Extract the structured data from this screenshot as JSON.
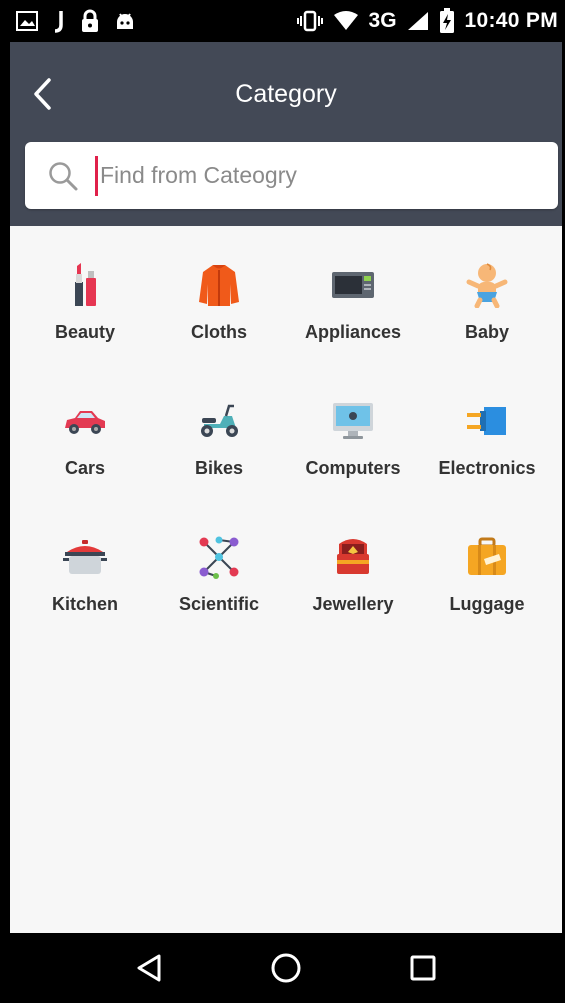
{
  "status_bar": {
    "network": "3G",
    "time": "10:40 PM",
    "left_icons": [
      "image-notification-icon",
      "j-notification-icon",
      "lock-icon",
      "android-icon"
    ],
    "right_icons": [
      "vibrate-icon",
      "wifi-icon",
      "signal-icon",
      "battery-charging-icon"
    ]
  },
  "header": {
    "title": "Category",
    "back_icon": "chevron-left-icon"
  },
  "search": {
    "placeholder": "Find from Cateogry",
    "value": "",
    "icon": "search-icon"
  },
  "categories": [
    {
      "label": "Beauty",
      "icon": "lipstick-icon"
    },
    {
      "label": "Cloths",
      "icon": "jacket-icon"
    },
    {
      "label": "Appliances",
      "icon": "microwave-icon"
    },
    {
      "label": "Baby",
      "icon": "baby-icon"
    },
    {
      "label": "Cars",
      "icon": "car-icon"
    },
    {
      "label": "Bikes",
      "icon": "scooter-icon"
    },
    {
      "label": "Computers",
      "icon": "imac-icon"
    },
    {
      "label": "Electronics",
      "icon": "plug-icon"
    },
    {
      "label": "Kitchen",
      "icon": "cooking-pot-icon"
    },
    {
      "label": "Scientific",
      "icon": "molecule-icon"
    },
    {
      "label": "Jewellery",
      "icon": "jewelry-box-icon"
    },
    {
      "label": "Luggage",
      "icon": "suitcase-icon"
    }
  ],
  "nav_bar": {
    "buttons": [
      "back-triangle-icon",
      "home-circle-icon",
      "recents-square-icon"
    ]
  },
  "colors": {
    "appbar": "#434956",
    "content_bg": "#f7f7f7",
    "cursor": "#e0204a"
  }
}
